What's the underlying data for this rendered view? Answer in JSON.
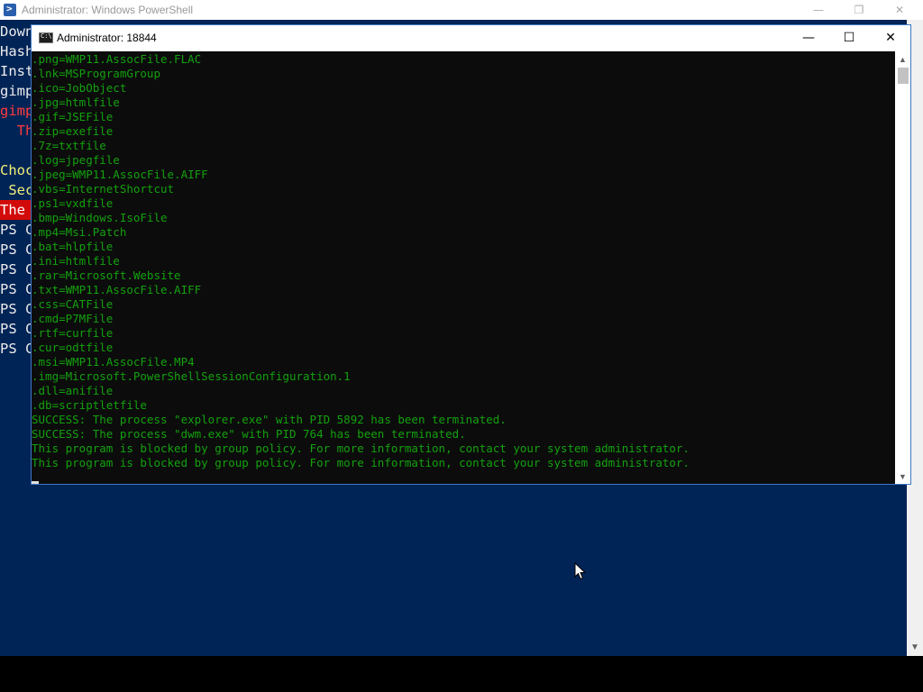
{
  "powershell": {
    "title": "Administrator: Windows PowerShell",
    "icon": "powershell-icon",
    "controls": {
      "minimize": "—",
      "restore": "❐",
      "close": "✕"
    },
    "visible_lines": [
      {
        "text": "Down",
        "style": "normal"
      },
      {
        "text": "Hash",
        "style": "normal"
      },
      {
        "text": "Inst",
        "style": "normal"
      },
      {
        "text": "gimp",
        "style": "normal"
      },
      {
        "text": "gimp",
        "style": "red"
      },
      {
        "text": "  Th",
        "style": "red"
      },
      {
        "text": "",
        "style": "normal"
      },
      {
        "text": "Choc",
        "style": "yellow"
      },
      {
        "text": " Sec",
        "style": "yellow"
      },
      {
        "text": "The ",
        "style": "redbg"
      },
      {
        "text": "PS C",
        "style": "normal"
      },
      {
        "text": "PS C",
        "style": "normal"
      },
      {
        "text": "PS C",
        "style": "normal"
      },
      {
        "text": "PS C",
        "style": "normal"
      },
      {
        "text": "PS C",
        "style": "normal"
      },
      {
        "text": "PS C",
        "style": "normal"
      },
      {
        "text": "PS C",
        "style": "normal"
      }
    ],
    "background_color": "#012456"
  },
  "cmd": {
    "title": "Administrator:  18844",
    "icon": "cmd-icon",
    "controls": {
      "minimize": "—",
      "maximize": "☐",
      "close": "✕"
    },
    "text_color": "#13a10e",
    "output_lines": [
      ".png=WMP11.AssocFile.FLAC",
      ".lnk=MSProgramGroup",
      ".ico=JobObject",
      ".jpg=htmlfile",
      ".gif=JSEFile",
      ".zip=exefile",
      ".7z=txtfile",
      ".log=jpegfile",
      ".jpeg=WMP11.AssocFile.AIFF",
      ".vbs=InternetShortcut",
      ".ps1=vxdfile",
      ".bmp=Windows.IsoFile",
      ".mp4=Msi.Patch",
      ".bat=hlpfile",
      ".ini=htmlfile",
      ".rar=Microsoft.Website",
      ".txt=WMP11.AssocFile.AIFF",
      ".css=CATFile",
      ".cmd=P7MFile",
      ".rtf=curfile",
      ".cur=odtfile",
      ".msi=WMP11.AssocFile.MP4",
      ".img=Microsoft.PowerShellSessionConfiguration.1",
      ".dll=anifile",
      ".db=scriptletfile",
      "SUCCESS: The process \"explorer.exe\" with PID 5892 has been terminated.",
      "SUCCESS: The process \"dwm.exe\" with PID 764 has been terminated.",
      "This program is blocked by group policy. For more information, contact your system administrator.",
      "This program is blocked by group policy. For more information, contact your system administrator."
    ]
  }
}
